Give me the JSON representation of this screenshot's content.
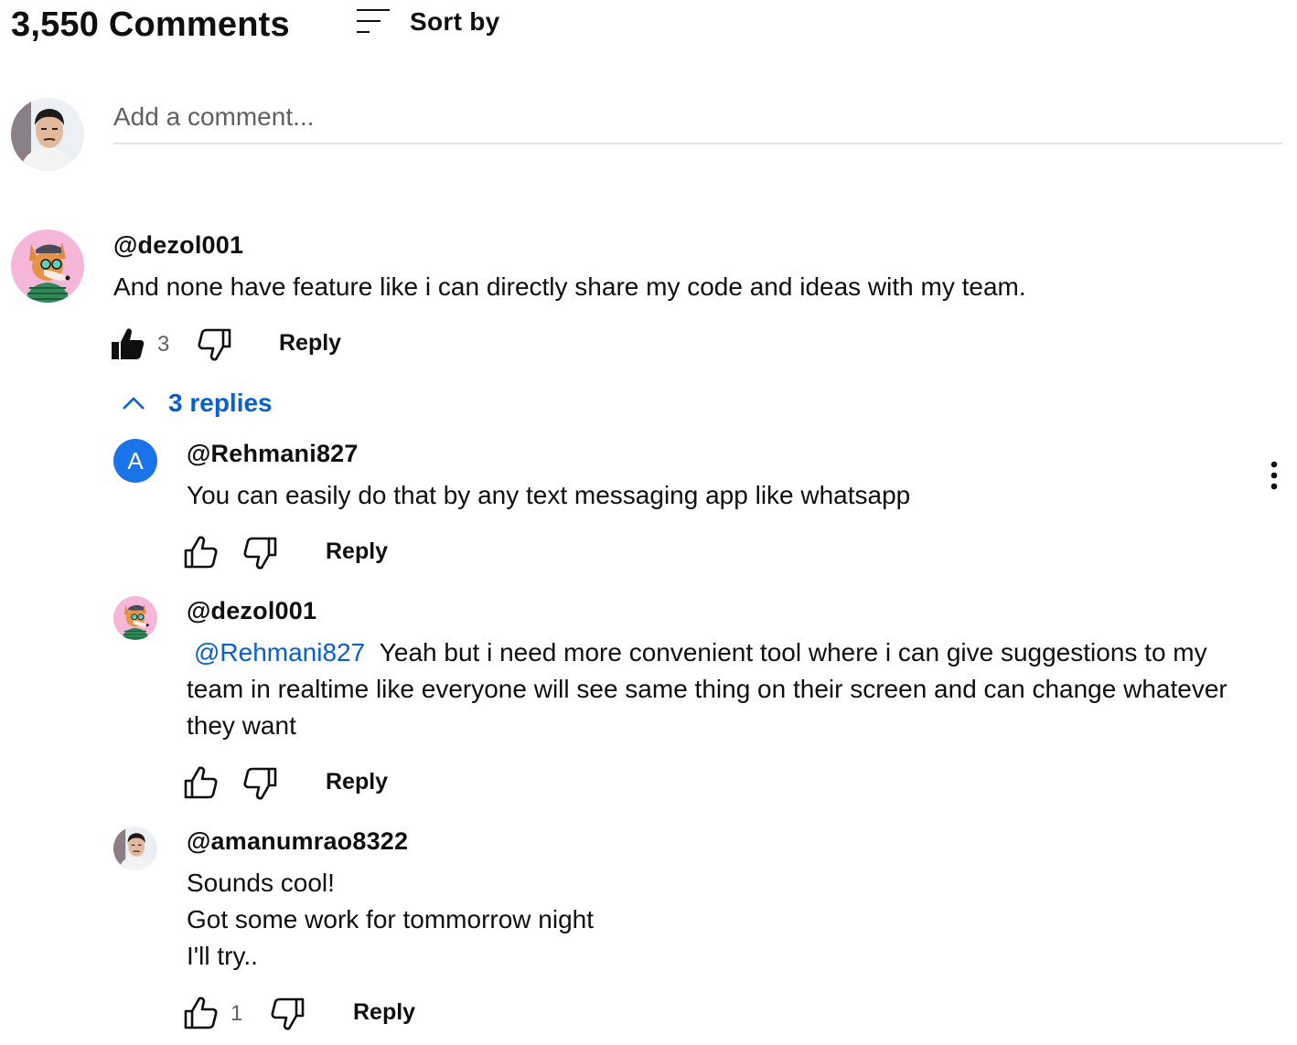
{
  "header": {
    "comments_count": "3,550 Comments",
    "sort_label": "Sort by"
  },
  "add_comment": {
    "placeholder": "Add a comment..."
  },
  "comment": {
    "author": "@dezol001",
    "text": "And none have feature like i can directly share my code and ideas with my team.",
    "likes": "3",
    "reply_label": "Reply",
    "replies_toggle": "3 replies"
  },
  "replies": [
    {
      "avatar_letter": "A",
      "author": "@Rehmani827",
      "text_lines": [
        "You can easily do that by any text messaging app like whatsapp"
      ],
      "likes": "",
      "reply_label": "Reply"
    },
    {
      "author": "@dezol001",
      "mention": "@Rehmani827",
      "text_lines": [
        "Yeah but i need more convenient tool where i can give suggestions to my",
        "team in realtime like everyone will see same thing on their screen and can change whatever",
        "they want"
      ],
      "likes": "",
      "reply_label": "Reply"
    },
    {
      "author": "@amanumrao8322",
      "text_lines": [
        "Sounds cool!",
        "Got some work for tommorrow night",
        "I'll try.."
      ],
      "likes": "1",
      "reply_label": "Reply"
    }
  ],
  "colors": {
    "link": "#065fd4",
    "secondary_text": "#606060",
    "avatar_letter_bg": "#1a73e8"
  },
  "icons": [
    "sort-icon",
    "thumbs-up-filled-icon",
    "thumbs-up-icon",
    "thumbs-down-icon",
    "chevron-up-icon",
    "more-vert-icon"
  ]
}
